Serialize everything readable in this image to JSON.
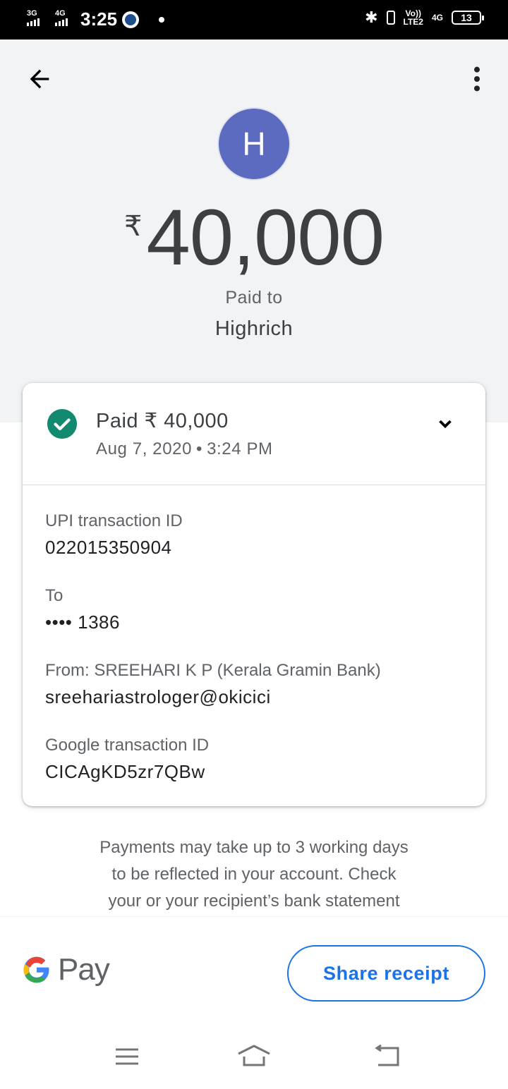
{
  "status_bar": {
    "network_left": "3G",
    "network_right": "4G",
    "time": "3:25",
    "volte": "Vo))",
    "lte": "LTE2",
    "network_4g": "4G",
    "battery": "13"
  },
  "header": {
    "avatar_letter": "H",
    "currency_symbol": "₹",
    "amount": "40,000",
    "paid_to_label": "Paid to",
    "payee_name": "Highrich"
  },
  "summary": {
    "paid_text": "Paid ₹ 40,000",
    "date": "Aug 7, 2020",
    "separator": "•",
    "time": "3:24 PM",
    "status_color": "#128a6f"
  },
  "details": {
    "upi_label": "UPI transaction ID",
    "upi_value": "022015350904",
    "to_label": "To",
    "to_value": "•••• 1386",
    "from_label": "From: SREEHARI K P (Kerala Gramin Bank)",
    "from_value": "sreehariastrologer@okicici",
    "google_label": "Google transaction ID",
    "google_value": "CICAgKD5zr7QBw"
  },
  "note": {
    "line1": "Payments may take up to 3 working days",
    "line2": "to be reflected in your account. Check",
    "line3": "your or your recipient’s bank statement"
  },
  "footer": {
    "brand_text": "Pay",
    "share_label": "Share receipt",
    "accent_color": "#1a73e8"
  },
  "icons": {
    "back": "arrow-left-icon",
    "more": "more-vert-icon",
    "status": "check-circle-icon",
    "expand": "chevron-down-icon",
    "nav_menu": "menu-icon",
    "nav_home": "home-icon",
    "nav_back": "back-icon"
  }
}
